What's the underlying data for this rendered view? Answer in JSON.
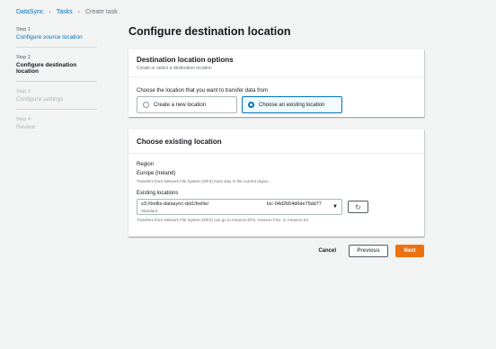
{
  "breadcrumb": {
    "service": "DataSync",
    "tasks": "Tasks",
    "current": "Create task"
  },
  "steps": [
    {
      "num": "Step 1",
      "title": "Configure source location",
      "state": "link"
    },
    {
      "num": "Step 2",
      "title": "Configure destination location",
      "state": "active"
    },
    {
      "num": "Step 3",
      "title": "Configure settings",
      "state": "disabled"
    },
    {
      "num": "Step 4",
      "title": "Review",
      "state": "disabled"
    }
  ],
  "page_title": "Configure destination location",
  "options_panel": {
    "title": "Destination location options",
    "description": "Create or select a destination location",
    "question": "Choose the location that you want to transfer data from",
    "option_new": "Create a new location",
    "option_existing": "Choose an existing location"
  },
  "existing_panel": {
    "title": "Choose existing location",
    "region_label": "Region",
    "region_value": "Europe (Ireland)",
    "region_hint": "Transfers from Network File System (NFS) must stay in the current region.",
    "locations_label": "Existing locations",
    "selected_path": "s3://trellis-datasync-dst1/trellis/",
    "selected_class": "Standard",
    "selected_id": "loc-04d2b54d6de75dd77",
    "locations_hint": "Transfers from Network File System (NFS) can go to Amazon EFS, Amazon FSx, or Amazon S3."
  },
  "actions": {
    "cancel": "Cancel",
    "previous": "Previous",
    "next": "Next"
  },
  "colors": {
    "link": "#0073bb",
    "primary": "#ec7211",
    "background": "#f2f3f3"
  },
  "icons": {
    "breadcrumb_separator": "chevron-right-icon",
    "dropdown": "caret-down-icon",
    "refresh": "refresh-icon"
  }
}
